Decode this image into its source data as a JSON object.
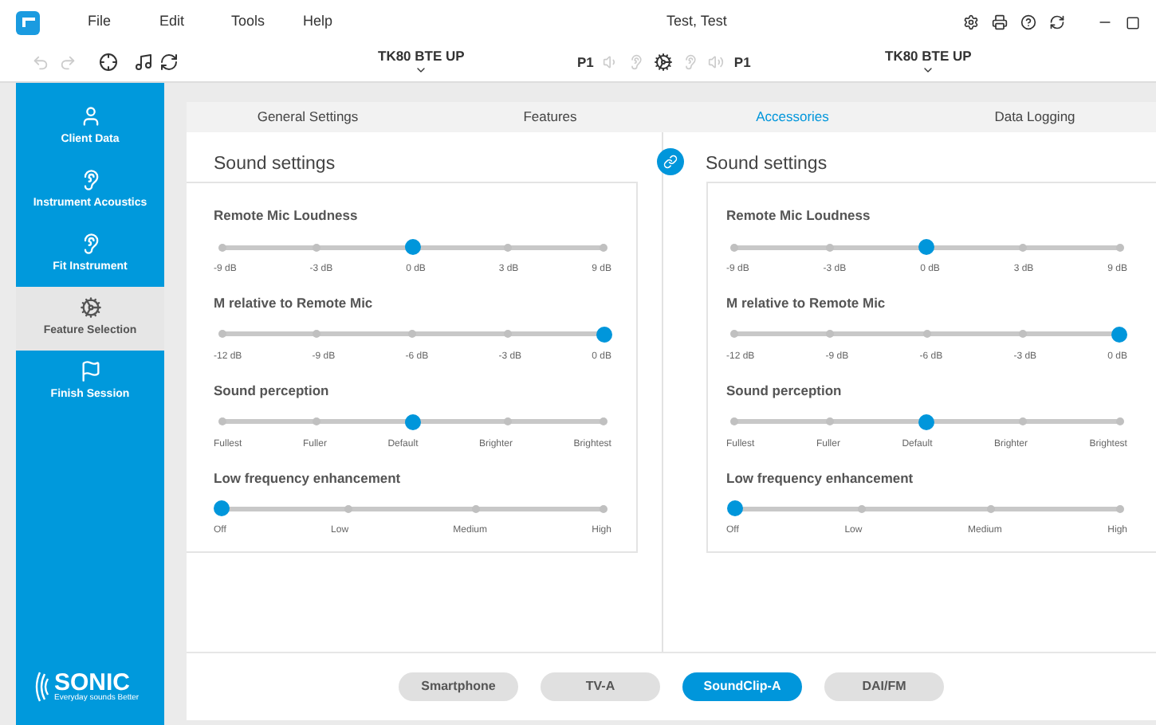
{
  "menu": [
    "File",
    "Edit",
    "Tools",
    "Help"
  ],
  "window": {
    "title": "Test, Test"
  },
  "toolbar": {
    "left_device": "TK80 BTE UP",
    "left_program": "P1",
    "right_program": "P1",
    "right_device": "TK80 BTE UP"
  },
  "sidebar": {
    "items": [
      {
        "label": "Client Data",
        "selected": false
      },
      {
        "label": "Instrument Acoustics",
        "selected": false
      },
      {
        "label": "Fit Instrument",
        "selected": false
      },
      {
        "label": "Feature Selection",
        "selected": true
      },
      {
        "label": "Finish Session",
        "selected": false
      }
    ],
    "logo": {
      "name": "SONIC",
      "tagline": "Everyday sounds Better"
    }
  },
  "tabs": [
    {
      "label": "General Settings",
      "selected": false
    },
    {
      "label": "Features",
      "selected": false
    },
    {
      "label": "Accessories",
      "selected": true
    },
    {
      "label": "Data Logging",
      "selected": false
    }
  ],
  "panels": [
    {
      "title": "Sound settings",
      "sliders": [
        {
          "label": "Remote Mic Loudness",
          "level": 0.5,
          "ticks": [
            "-9 dB",
            "-3 dB",
            "0 dB",
            "3 dB",
            "9 dB"
          ]
        },
        {
          "label": "M relative to Remote Mic",
          "level": 1,
          "ticks": [
            "-12 dB",
            "-9 dB",
            "-6 dB",
            "-3 dB",
            "0 dB"
          ]
        },
        {
          "label": "Sound perception",
          "level": 0.5,
          "ticks": [
            "Fullest",
            "Fuller",
            "Default",
            "Brighter",
            "Brightest"
          ]
        },
        {
          "label": "Low frequency enhancement",
          "level": 0,
          "ticks": [
            "Off",
            "Low",
            "Medium",
            "High"
          ]
        }
      ]
    },
    {
      "title": "Sound settings",
      "sliders": [
        {
          "label": "Remote Mic Loudness",
          "level": 0.5,
          "ticks": [
            "-9 dB",
            "-3 dB",
            "0 dB",
            "3 dB",
            "9 dB"
          ]
        },
        {
          "label": "M relative to Remote Mic",
          "level": 1,
          "ticks": [
            "-12 dB",
            "-9 dB",
            "-6 dB",
            "-3 dB",
            "0 dB"
          ]
        },
        {
          "label": "Sound perception",
          "level": 0.5,
          "ticks": [
            "Fullest",
            "Fuller",
            "Default",
            "Brighter",
            "Brightest"
          ]
        },
        {
          "label": "Low frequency enhancement",
          "level": 0,
          "ticks": [
            "Off",
            "Low",
            "Medium",
            "High"
          ]
        }
      ]
    }
  ],
  "accessories": [
    {
      "label": "Smartphone",
      "selected": false
    },
    {
      "label": "TV-A",
      "selected": false
    },
    {
      "label": "SoundClip-A",
      "selected": true
    },
    {
      "label": "DAI/FM",
      "selected": false
    }
  ]
}
